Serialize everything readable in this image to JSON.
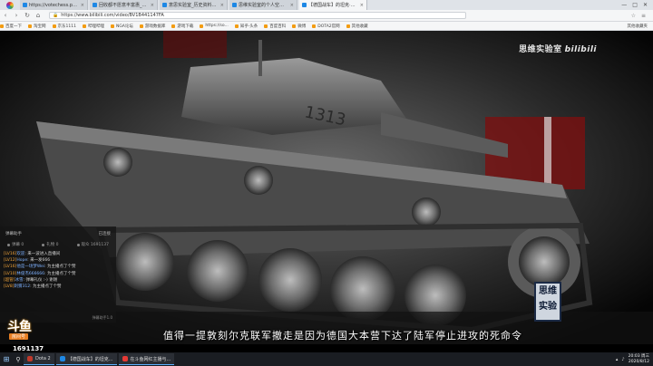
{
  "browser": {
    "tabs": [
      {
        "label": "https://votechess.pplicious.cn"
      },
      {
        "label": "回收都不愿意丰富惠_历史都记录"
      },
      {
        "label": "意思实验室_历史资料解析"
      },
      {
        "label": "思维实验室的个人空间 - 哔哩哔"
      },
      {
        "label": "【德国战车】的坦克·思维实验"
      }
    ],
    "active_tab": 4,
    "url": "https://www.bilibili.com/video/BV1B441147FA",
    "bookmarks": [
      "百度一下",
      "淘宝网",
      "京东1111",
      "哔哩哔哩",
      "NGA论坛",
      "游戏数据库",
      "游戏下载",
      "https://so...",
      "知乎·头条",
      "百度百科",
      "微博",
      "DOTA2官网",
      "其他收藏"
    ],
    "bookmarks_right": "其他收藏夹"
  },
  "video": {
    "watermark_text": "思维实验室",
    "watermark_brand": "bilibili",
    "subtitle": "值得一提敦刻尔克联军撤走是因为德国大本营下达了陆军停止进攻的死命令",
    "seal_line1": "思维",
    "seal_line2": "实验"
  },
  "overlay": {
    "title": "弹幕助手",
    "status": "已连接",
    "stats": [
      "弹幕 0",
      "礼物 0",
      "观众 1691137"
    ],
    "chat": [
      {
        "lvl": "[LV16]",
        "user": "欢迎",
        "text": "来一波进入直播间"
      },
      {
        "lvl": "[LV12]",
        "user": "Hope",
        "text": "来一发666"
      },
      {
        "lvl": "[LV16]",
        "user": "他是一场梦Wei",
        "text": "为主播点了个赞"
      },
      {
        "lvl": "[LV10]",
        "user": "林俊杰666666",
        "text": "为主播点了个赞"
      },
      {
        "lvl": "[超管]",
        "user": "冰雪",
        "text": "弹幕礼仪 :-) 谢谢"
      },
      {
        "lvl": "[LV8]",
        "user": "刺猬312",
        "text": "为主播点了个赞"
      }
    ],
    "footer": "弹幕助手1.0"
  },
  "douyu": {
    "logo_big": "斗鱼",
    "logo_small": "房间号",
    "room_number": "1691137"
  },
  "taskbar": {
    "items": [
      {
        "label": "Dota 2",
        "color": "#c0392b"
      },
      {
        "label": "【德国战车】的坦克...",
        "color": "#1e88e5"
      },
      {
        "label": "在斗鱼网红主播与...",
        "color": "#e53935"
      }
    ],
    "time": "20:03",
    "weekday": "周三",
    "date": "2020/8/12"
  },
  "colors": {
    "accent": "#5ab0ff",
    "seal_border": "#1b2a45",
    "flag_red": "#7a1010"
  }
}
